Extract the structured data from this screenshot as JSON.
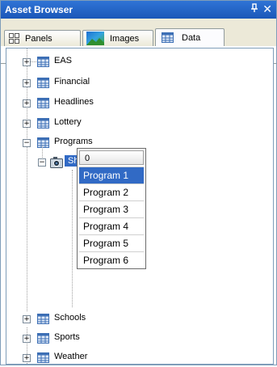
{
  "window": {
    "title": "Asset Browser",
    "pin_glyph": "⍑",
    "close_glyph": "✕"
  },
  "tabs": [
    {
      "label": "Panels",
      "icon": "panels-icon"
    },
    {
      "label": "Images",
      "icon": "images-icon"
    },
    {
      "label": "Data",
      "icon": "data-table-icon",
      "active": true
    }
  ],
  "tree": {
    "nodes_top": [
      {
        "label": "EAS",
        "expanded": false
      },
      {
        "label": "Financial",
        "expanded": false
      },
      {
        "label": "Headlines",
        "expanded": false
      },
      {
        "label": "Lottery",
        "expanded": false
      },
      {
        "label": "Programs",
        "expanded": true
      }
    ],
    "child": {
      "label": "Shows_Listings",
      "expanded": true,
      "icon": "camera-icon"
    },
    "dropdown": {
      "header": "0",
      "items": [
        "Program 1",
        "Program 2",
        "Program 3",
        "Program 4",
        "Program 5",
        "Program 6"
      ],
      "selected_index": 0
    },
    "nodes_bottom": [
      {
        "label": "Schools",
        "expanded": false
      },
      {
        "label": "Sports",
        "expanded": false
      },
      {
        "label": "Weather",
        "expanded": false
      }
    ]
  },
  "colors": {
    "selection": "#316ac5",
    "titlebar": "#1b57b8"
  }
}
